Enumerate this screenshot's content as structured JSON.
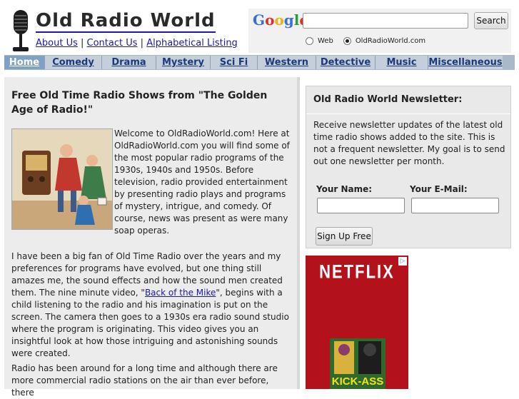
{
  "header": {
    "site_title": "Old Radio World",
    "links": {
      "about": "About Us",
      "contact": "Contact Us",
      "alphabetical": "Alphabetical Listing",
      "separator": "|"
    }
  },
  "search": {
    "logo": "Google",
    "button_label": "Search",
    "query_value": "",
    "options": [
      "Web",
      "OldRadioWorld.com"
    ],
    "selected_option": "OldRadioWorld.com"
  },
  "nav": {
    "items": [
      {
        "label": "Home",
        "active": true
      },
      {
        "label": "Comedy",
        "active": false
      },
      {
        "label": "Drama",
        "active": false
      },
      {
        "label": "Mystery",
        "active": false
      },
      {
        "label": "Sci Fi",
        "active": false
      },
      {
        "label": "Western",
        "active": false
      },
      {
        "label": "Detective",
        "active": false
      },
      {
        "label": "Music",
        "active": false
      },
      {
        "label": "Miscellaneous",
        "active": false
      }
    ]
  },
  "main": {
    "title": "Free Old Time Radio Shows from \"The Golden Age of Radio!\"",
    "intro": "Welcome to OldRadioWorld.com! Here at OldRadioWorld.com you will find some of the most popular radio programs of the 1930s, 1940s and 1950s. Before television, radio provided entertainment by presenting radio plays and programs of mystery, intrigue, and comedy. Of course, news was present as were many soap operas.",
    "para2_before": "I have been a big fan of Old Time Radio over the years and my preferences for programs have evolved, but one thing still amazes me, the sound effects and how the sound men created them. The nine minute video, \"",
    "para2_link": "Back of the Mike",
    "para2_after": "\", begins with a child listening to the radio and his imagination is put on the screen. The camera then goes to a 1930s era radio sound studio where the program is originating. This video gives you an insightful look at how those intriguing and astonishing sounds were created.",
    "para3": "Radio has been around for a long time and although there are more commercial radio stations on the air than ever before, there"
  },
  "newsletter": {
    "title": "Old Radio World Newsletter:",
    "text": "Receive newsletter updates of the latest old time radio shows added to the site. This is not a frequent newsletter. My goal is to send out one newsletter per month.",
    "name_label": "Your Name:",
    "email_label": "Your E-Mail:",
    "name_value": "",
    "email_value": "",
    "submit_label": "Sign Up Free"
  },
  "ad": {
    "brand": "NETFLIX",
    "poster_title": "KICK-ASS",
    "badge": "▷"
  },
  "colors": {
    "nav_bg": "#c4cfdb",
    "nav_active": "#7fa1c4",
    "link": "#1a1aa6",
    "ad_red": "#b3121b"
  }
}
